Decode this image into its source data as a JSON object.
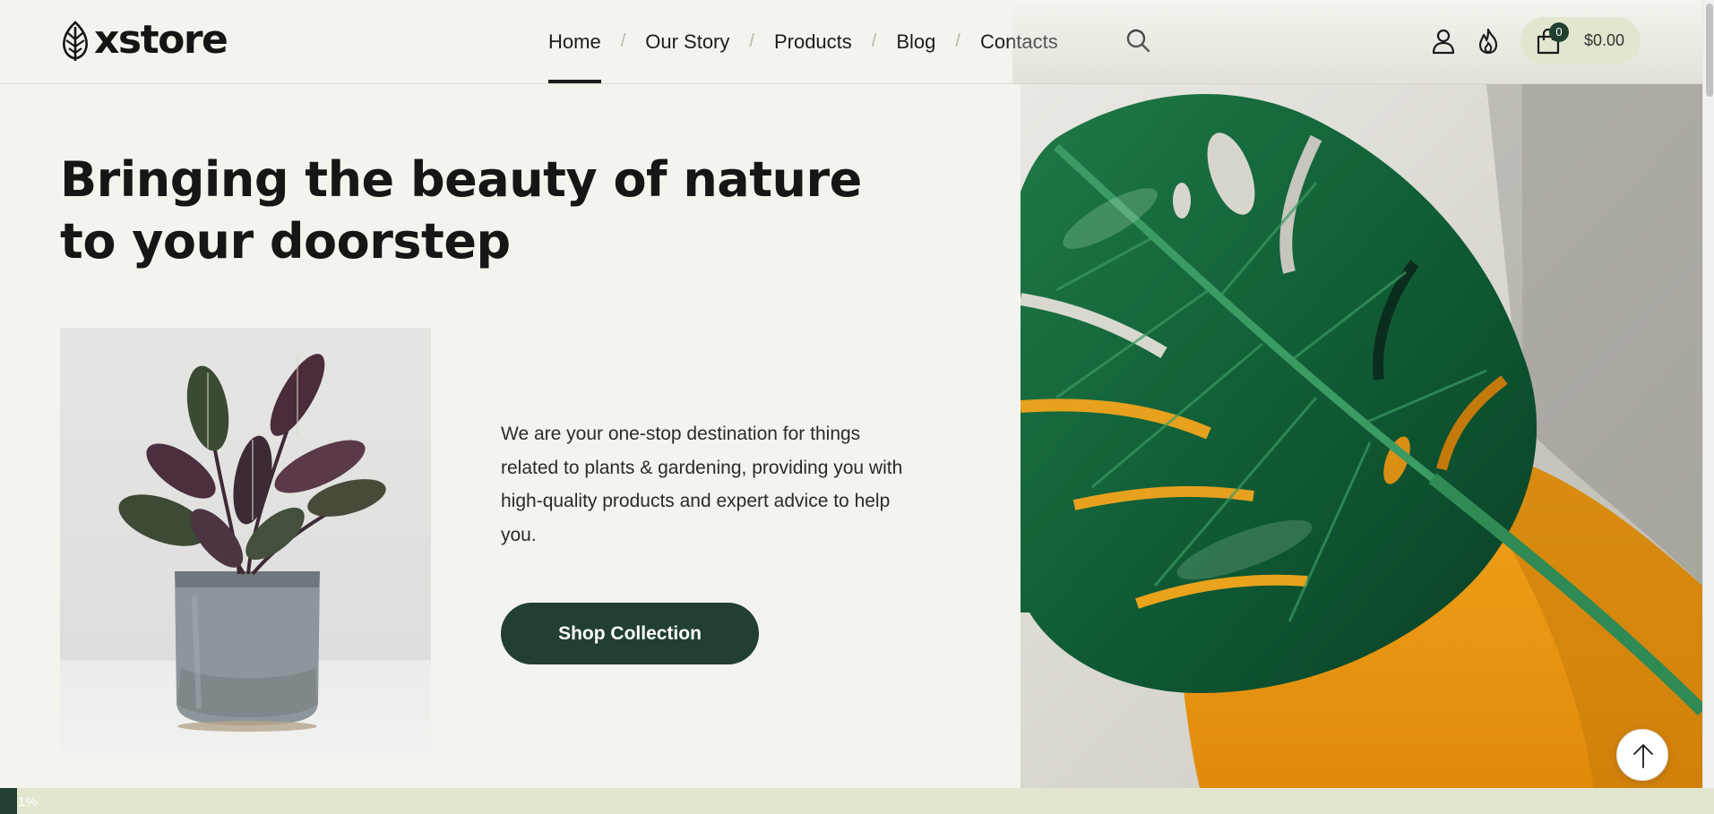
{
  "brand": {
    "name": "xstore",
    "logo_icon": "leaf-icon"
  },
  "nav": {
    "items": [
      {
        "label": "Home",
        "active": true
      },
      {
        "label": "Our Story",
        "active": false
      },
      {
        "label": "Products",
        "active": false
      },
      {
        "label": "Blog",
        "active": false
      },
      {
        "label": "Contacts",
        "active": false
      }
    ],
    "separator": "/"
  },
  "header_actions": {
    "search_icon": "search-icon",
    "account_icon": "user-icon",
    "wishlist_icon": "flame-icon",
    "cart": {
      "icon": "shopping-bag-icon",
      "count": "0",
      "total": "$0.00"
    }
  },
  "hero": {
    "headline": "Bringing the beauty of nature to your doorstep",
    "intro": "We are your one-stop destination for things related to plants & gardening, providing you with high-quality products and expert advice to help you.",
    "cta_label": "Shop Collection"
  },
  "scroll_top": {
    "icon": "arrow-up-icon"
  },
  "reading_progress": {
    "percent": 1,
    "label": "1%"
  },
  "colors": {
    "background": "#f4f4ee",
    "brand_dark_green": "#21402f",
    "accent_pale_green": "#e3e6cf",
    "text": "#1a1a1a"
  }
}
